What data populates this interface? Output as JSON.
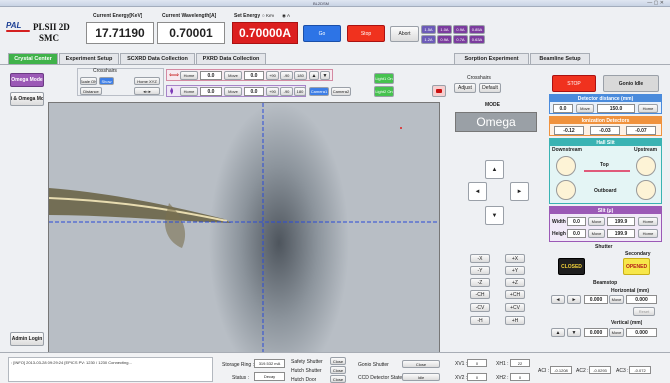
{
  "window": {
    "title": "BL2DSM"
  },
  "header": {
    "logo_text": "PAL",
    "app_line1": "PLSII 2D",
    "app_line2": "SMC",
    "energy_label": "Current Energy[KeV]",
    "energy_value": "17.71190",
    "wavelength_label": "Current Wavelength[A]",
    "wavelength_value": "0.70001",
    "set_energy_label": "Set Energy",
    "unit_kev": "KeV",
    "unit_a": "A",
    "set_value": "0.70000A",
    "go_label": "Go",
    "stop_label": "Stop",
    "abort_label": "Abort",
    "aperture_row1": [
      "1.5A",
      "1.0A",
      "0.9A",
      "0.85A"
    ],
    "aperture_row2": [
      "1.2A",
      "0.9A",
      "0.7A",
      "0.63A"
    ]
  },
  "tabs": [
    "Crystal Center",
    "Experiment Setup",
    "SCXRD Data Collection",
    "PXRD Data Collection"
  ],
  "right_tabs": [
    "Sorption Experiment",
    "Beamline Setup"
  ],
  "left": {
    "omega_mode": "Omega Mode",
    "phi_omega_mode": "Phi & Omega Mode",
    "admin_login": "Admin Login"
  },
  "crosshairs": {
    "title": "Crosshairs",
    "scale_on": "Scale ON",
    "show": "Show",
    "distance": "Distance",
    "home_xyz": "Home XYZ"
  },
  "motor_rows": [
    {
      "home": "Home",
      "value": "0.0",
      "move": "Move",
      "value2": "0.0",
      "p90": "+90",
      "m90": "-90",
      "d180": "180"
    },
    {
      "home": "Home",
      "value": "0.0",
      "move": "Move",
      "value2": "0.0",
      "p90": "+90",
      "m90": "-90",
      "d180": "180"
    }
  ],
  "camera": {
    "camera1": "Camera1",
    "camera2": "Camera2",
    "light1": "Light1 On",
    "light2": "Light2 On"
  },
  "crosshairs_right": {
    "title": "Crosshairs",
    "adjust": "Adjust",
    "default": "Default"
  },
  "mode": {
    "label": "MODE",
    "value": "Omega"
  },
  "jog": {
    "left_col": [
      "-X",
      "-Y",
      "-Z",
      "-CH",
      "-CV",
      "-H"
    ],
    "right_col": [
      "+X",
      "+Y",
      "+Z",
      "+CH",
      "+CV",
      "+H"
    ]
  },
  "right_panel": {
    "stop": "STOP",
    "gonio_idle": "Gonio Idle",
    "detector_title": "Detector distance (mm)",
    "detector_value": "0.0",
    "detector_move": "Move",
    "detector_set": "150.0",
    "detector_home": "Home",
    "ion_title": "Ionization Detectors",
    "ion_values": [
      "-0.12",
      "-0.03",
      "-0.07"
    ],
    "hall_title": "Hall Slit",
    "downstream": "Downstream",
    "upstream": "Upstream",
    "top": "Top",
    "outboard": "Outboard",
    "slit_title": "Slit (μ)",
    "width_label": "Width",
    "width_value": "0.0",
    "width_move": "Move",
    "width_set": "199.9",
    "width_home": "Home",
    "height_label": "Heigh",
    "height_value": "0.0",
    "height_move": "Move",
    "height_set": "199.9",
    "height_home": "Home",
    "shutter_title": "Shutter",
    "secondary": "Secondary",
    "closed": "CLOSED",
    "opened": "OPENED",
    "beamstop_title": "Beamstop",
    "horizontal_title": "Horizontal (mm)",
    "h_value": "0.000",
    "h_move": "Move",
    "h_set": "0.000",
    "reset": "Reset",
    "vertical_title": "Vertical (mm)",
    "v_value": "0.000",
    "v_move": "Move",
    "v_set": "0.000"
  },
  "status": {
    "log": ": [INFO] 2013-03-28 09:29:24 [EPICS PV: 1230 / 1230 Connecting...",
    "storage_ring_label": "Storage Ring :",
    "storage_ring_value": "319.532 mA",
    "status_label": "Status :",
    "status_value": "Decay",
    "safety_shutter": "Safety Shutter",
    "hutch_shutter": "Hutch Shutter",
    "hutch_door": "Hutch Door",
    "close": "Close",
    "gonio_shutter": "Gonio Shutter",
    "gonio_close": "Close",
    "ccd_state": "CCD Detector State",
    "ccd_value": "Idle",
    "xv1_label": "XV1 :",
    "xv1": "0",
    "xh1_label": "XH1 :",
    "xh1": "22",
    "xv2_label": "XV2 :",
    "xv2": "0",
    "xh2_label": "XH2 :",
    "xh2": "0",
    "ac1_label": "ACI :",
    "ac1": "-0.1208",
    "ac2_label": "AC2 :",
    "ac2": "-0.0293",
    "ac3_label": "AC3 :",
    "ac3": "-0.072"
  }
}
